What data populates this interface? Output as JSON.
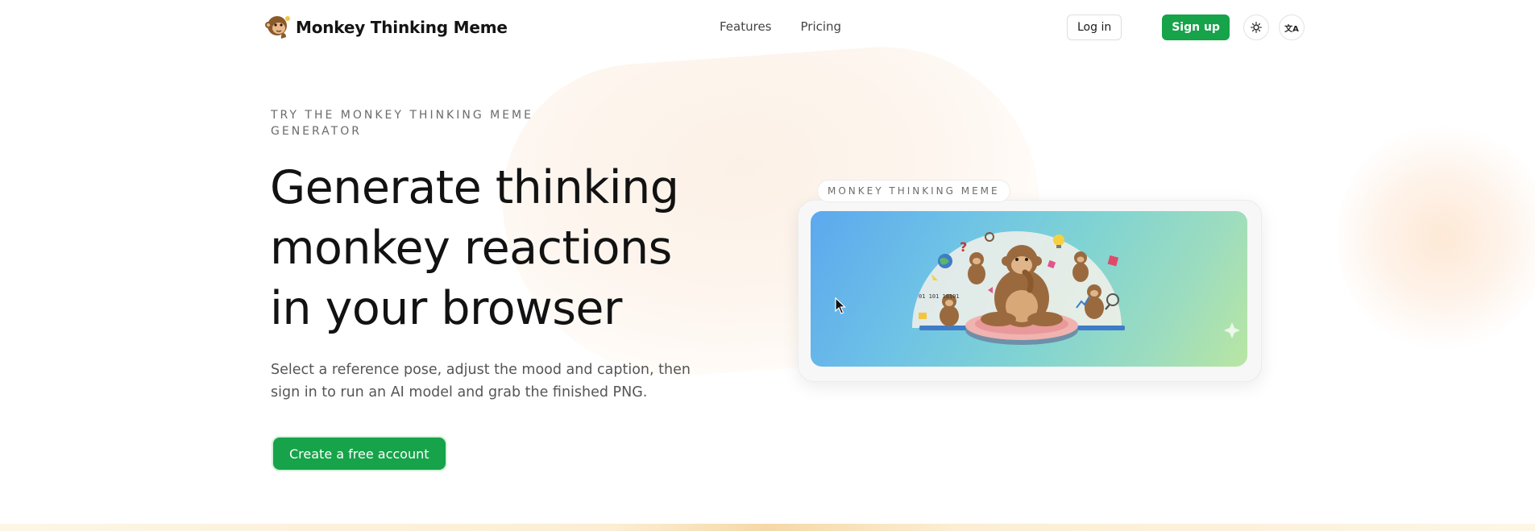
{
  "nav": {
    "brand": "Monkey Thinking Meme",
    "links": [
      "Features",
      "Pricing"
    ],
    "login": "Log in",
    "signup": "Sign up",
    "lang_glyph": "文A"
  },
  "hero": {
    "eyebrow": "TRY THE MONKEY THINKING MEME GENERATOR",
    "headline": "Generate thinking monkey reactions in your browser",
    "subtext": "Select a reference pose, adjust the mood and caption, then sign in to run an AI model and grab the finished PNG.",
    "cta": "Create a free account"
  },
  "preview": {
    "chip": "MONKEY THINKING MEME",
    "binary_text": "01 101 10101"
  },
  "colors": {
    "accent_green": "#16a34a",
    "preview_gradient_start": "#5ca8ee",
    "preview_gradient_end": "#b9e6a2"
  },
  "icons": [
    "monkey-logo-icon",
    "sun-icon",
    "translate-icon",
    "sparkle-icon",
    "cursor-icon"
  ]
}
